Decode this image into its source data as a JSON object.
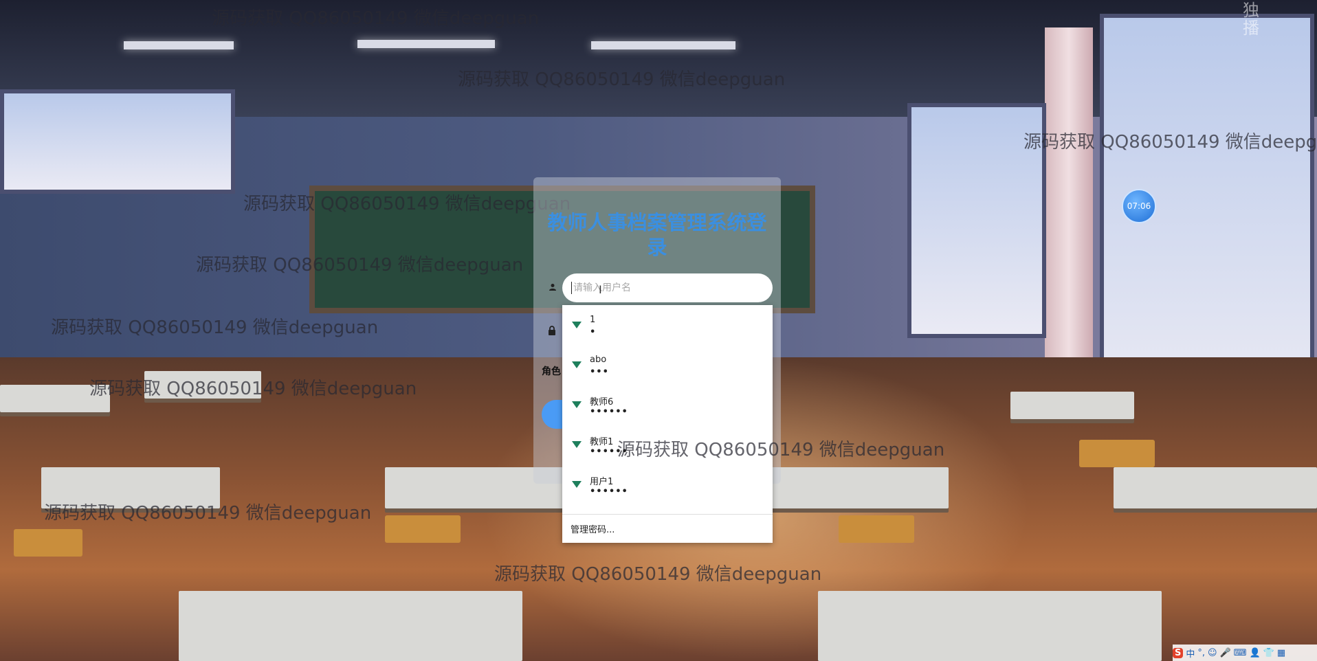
{
  "login": {
    "title": "教师人事档案管理系统登录",
    "username_placeholder": "请输入用户名",
    "role_label": "角色"
  },
  "autofill": {
    "items": [
      {
        "username": "1",
        "password_mask": "•"
      },
      {
        "username": "abo",
        "password_mask": "•••"
      },
      {
        "username": "教师6",
        "password_mask": "••••••"
      },
      {
        "username": "教师1",
        "password_mask": "••••••"
      },
      {
        "username": "用户1",
        "password_mask": "••••••"
      }
    ],
    "manage_label": "管理密码..."
  },
  "watermark": "源码获取 QQ86050149 微信deepguan",
  "clock": "07:06",
  "corner_text": "独 播",
  "tray": {
    "brand": "S",
    "lang": "中",
    "punct": "°,",
    "icons": [
      "emoji-icon",
      "microphone-icon",
      "keyboard-icon",
      "user-icon",
      "shirt-icon",
      "grid-icon"
    ]
  },
  "colors": {
    "title": "#3b8fe0",
    "login_button": "#4a9bf5",
    "key_icon": "#1e7f5c"
  }
}
